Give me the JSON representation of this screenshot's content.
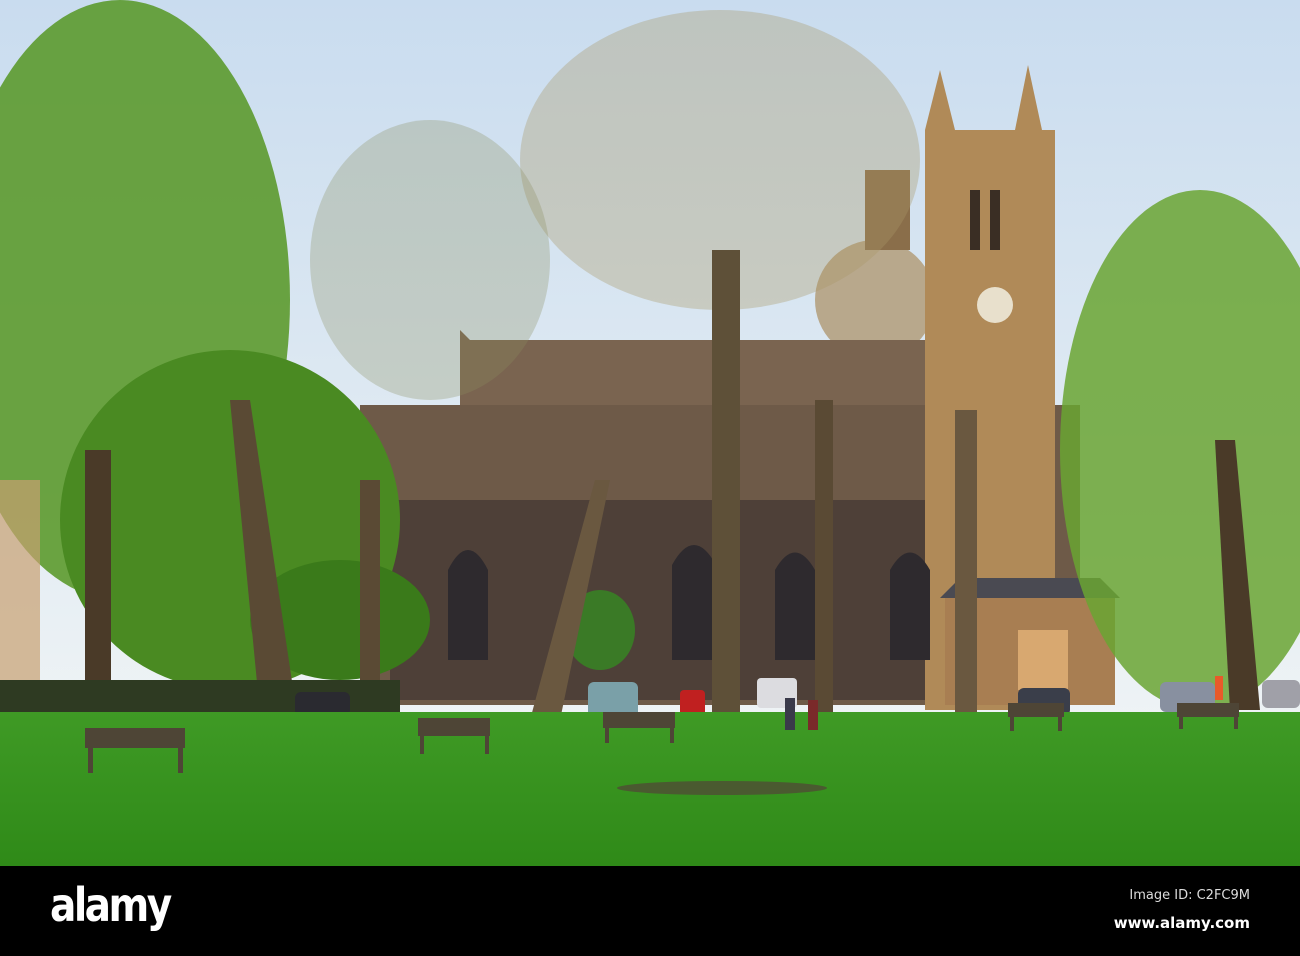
{
  "photo": {
    "subject": "church-in-park",
    "colors": {
      "sky": "#dfeaf5",
      "grass": "#3e9a22",
      "stone": "#8a6a45",
      "foliage": "#5a9a2a",
      "trunk": "#4a3a28"
    }
  },
  "footer": {
    "logo": "alamy",
    "image_id": "Image ID: C2FC9M",
    "website": "www.alamy.com"
  }
}
